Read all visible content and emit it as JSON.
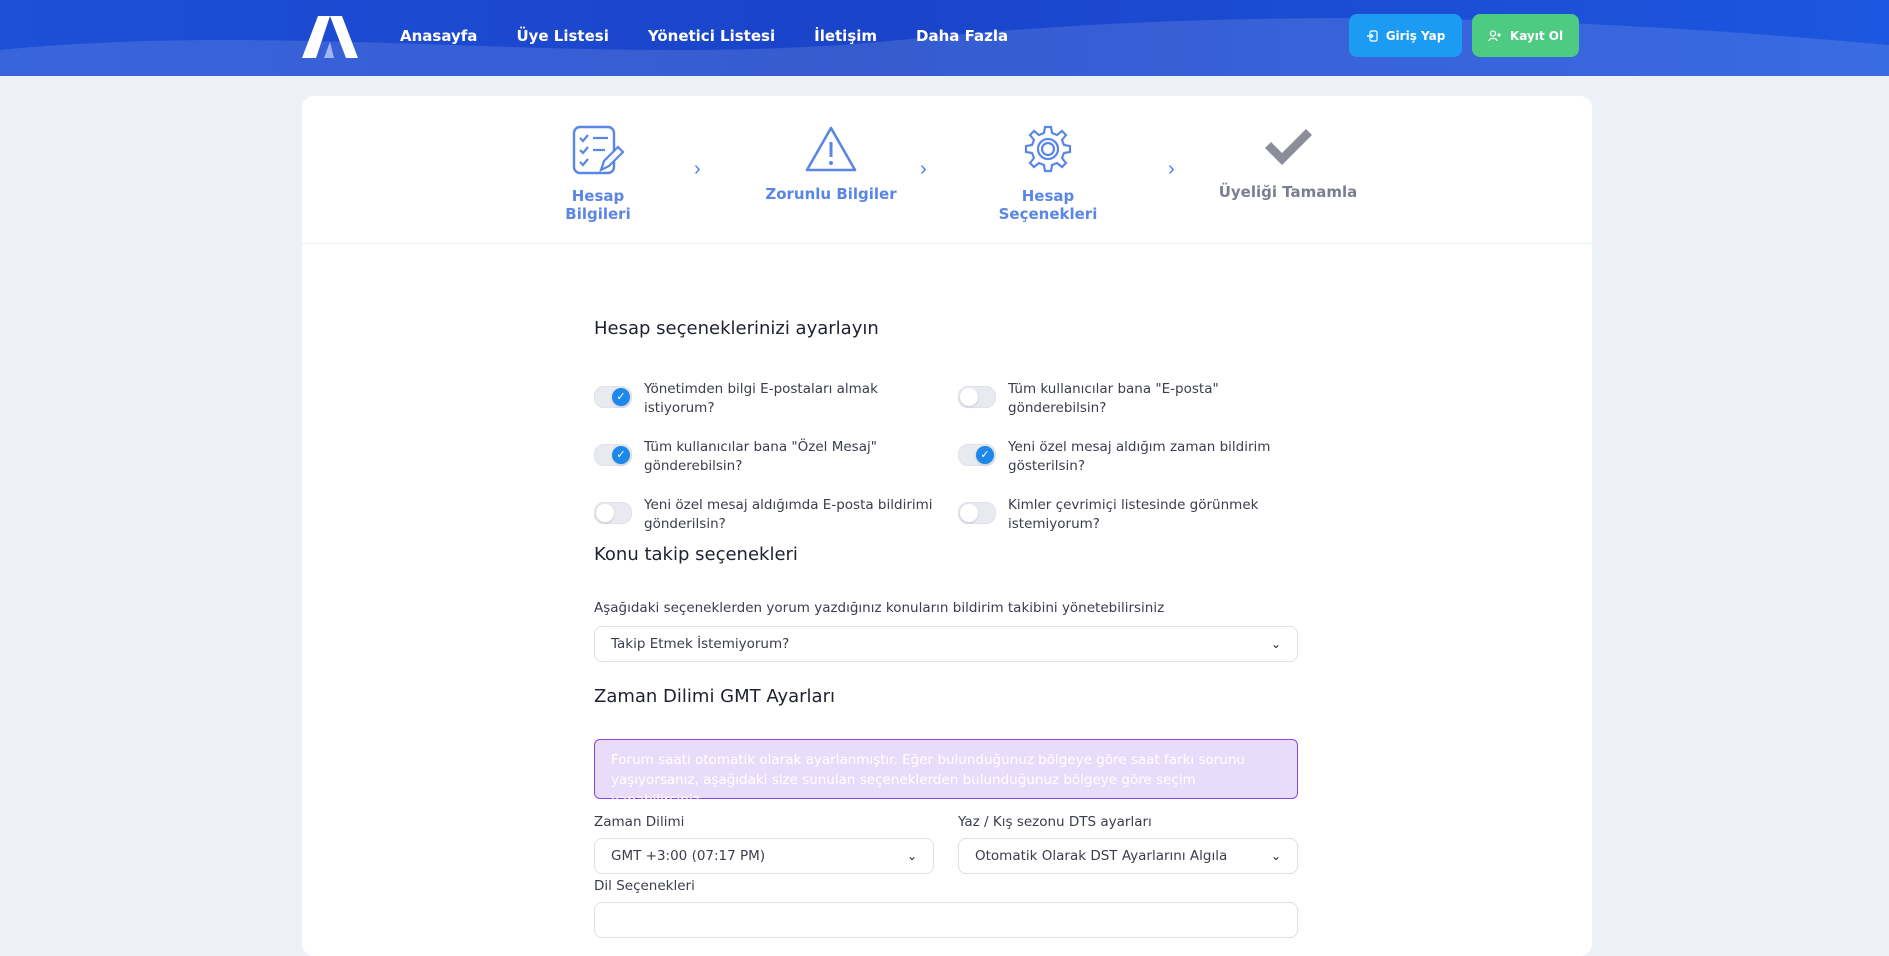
{
  "nav": {
    "items": [
      "Anasayfa",
      "Üye Listesi",
      "Yönetici Listesi",
      "İletişim",
      "Daha Fazla"
    ],
    "login_label": "Giriş Yap",
    "register_label": "Kayıt Ol"
  },
  "steps": [
    {
      "label": "Hesap Bilgileri",
      "icon": "checklist-icon"
    },
    {
      "label": "Zorunlu Bilgiler",
      "icon": "warning-icon"
    },
    {
      "label": "Hesap Seçenekleri",
      "icon": "gear-icon"
    },
    {
      "label": "Üyeliği Tamamla",
      "icon": "checkmark-icon"
    }
  ],
  "account": {
    "title": "Hesap seçeneklerinizi ayarlayın",
    "options": [
      {
        "text": "Yönetimden bilgi E-postaları almak istiyorum?",
        "on": true
      },
      {
        "text": "Tüm kullanıcılar bana \"E-posta\" gönderebilsin?",
        "on": false
      },
      {
        "text": "Tüm kullanıcılar bana \"Özel Mesaj\" gönderebilsin?",
        "on": true
      },
      {
        "text": "Yeni özel mesaj aldığım zaman bildirim gösterilsin?",
        "on": true
      },
      {
        "text": "Yeni özel mesaj aldığımda E-posta bildirimi gönderilsin?",
        "on": false
      },
      {
        "text": "Kimler çevrimiçi listesinde görünmek istemiyorum?",
        "on": false
      }
    ]
  },
  "topic": {
    "title": "Konu takip seçenekleri",
    "description": "Aşağıdaki seçeneklerden yorum yazdığınız konuların bildirim takibini yönetebilirsiniz",
    "selected": "Takip Etmek İstemiyorum?"
  },
  "timezone": {
    "title": "Zaman Dilimi GMT Ayarları",
    "alert": "Forum saati otomatik olarak ayarlanmıştır. Eğer bulunduğunuz bölgeye göre saat farkı sorunu yaşıyorsanız, aşağıdaki size sunulan seçeneklerden bulunduğunuz bölgeye göre seçim yapabilirsiniz.",
    "zone_label": "Zaman Dilimi",
    "zone_value": "GMT +3:00 (07:17 PM)",
    "dst_label": "Yaz / Kış sezonu DTS ayarları",
    "dst_value": "Otomatik Olarak DST Ayarlarını Algıla",
    "lang_label": "Dil Seçenekleri"
  }
}
